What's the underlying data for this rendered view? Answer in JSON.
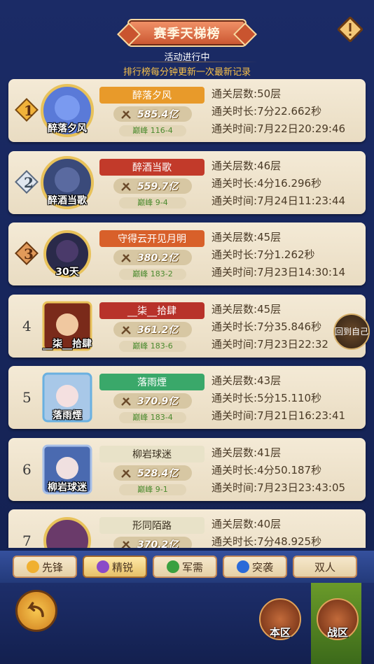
{
  "header": {
    "title": "赛季天梯榜",
    "status": "活动进行中",
    "note": "排行榜每分钟更新一次最新记录"
  },
  "labels": {
    "floors_prefix": "通关层数:",
    "duration_prefix": "通关时长:",
    "time_prefix": "通关时间:"
  },
  "rows": [
    {
      "rank": "1",
      "name": "醉落夕风",
      "power": "585.4亿",
      "server": "巅峰 116-4",
      "floors": "50层",
      "duration": "7分22.662秒",
      "time": "7月22日20:29:46",
      "banner_color": "#e89a2a"
    },
    {
      "rank": "2",
      "name": "醉酒当歌",
      "power": "559.7亿",
      "server": "巅峰 9-4",
      "floors": "46层",
      "duration": "4分16.296秒",
      "time": "7月24日11:23:44",
      "banner_color": "#c23a2a"
    },
    {
      "rank": "3",
      "name": "守得云开见月明",
      "avatar_name": "30天",
      "power": "380.2亿",
      "server": "巅峰 183-2",
      "floors": "45层",
      "duration": "7分1.262秒",
      "time": "7月23日14:30:14",
      "banner_color": "#d8602a"
    },
    {
      "rank": "4",
      "name": "__柒__拾肆",
      "power": "361.2亿",
      "server": "巅峰 183-6",
      "floors": "45层",
      "duration": "7分35.846秒",
      "time": "7月23日22:32",
      "banner_color": "#b8322a"
    },
    {
      "rank": "5",
      "name": "落雨煙",
      "power": "370.9亿",
      "server": "巅峰 183-4",
      "floors": "43层",
      "duration": "5分15.110秒",
      "time": "7月21日16:23:41",
      "banner_color": "#3aa86a"
    },
    {
      "rank": "6",
      "name": "柳岩球迷",
      "power": "528.4亿",
      "server": "巅峰 9-1",
      "floors": "41层",
      "duration": "4分50.187秒",
      "time": "7月23日23:43:05",
      "banner_color": "#e8e2c8"
    },
    {
      "rank": "7",
      "name": "形同陌路",
      "power": "370.2亿",
      "server": "",
      "floors": "40层",
      "duration": "7分48.925秒",
      "time": "",
      "banner_color": "#e8e2c8"
    }
  ],
  "back_to_self": "回到自己",
  "tabs": [
    {
      "label": "先锋",
      "icon": "shield-icon",
      "color": "#f0b030"
    },
    {
      "label": "精锐",
      "icon": "bow-icon",
      "color": "#8a4ac8"
    },
    {
      "label": "军需",
      "icon": "leaf-icon",
      "color": "#3aa040"
    },
    {
      "label": "突袭",
      "icon": "swirl-icon",
      "color": "#2a6ad8"
    },
    {
      "label": "双人",
      "icon": "",
      "color": ""
    }
  ],
  "bottom": {
    "region_label": "本区",
    "war_label": "战区"
  }
}
